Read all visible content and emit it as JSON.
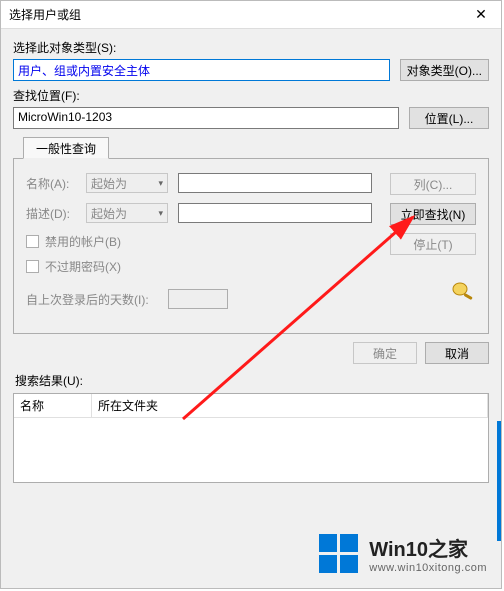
{
  "title": "选择用户或组",
  "section": {
    "objectTypeLabel": "选择此对象类型(S):",
    "objectTypeValue": "用户、组或内置安全主体",
    "objectTypeBtn": "对象类型(O)...",
    "locationLabel": "查找位置(F):",
    "locationValue": "MicroWin10-1203",
    "locationBtn": "位置(L)..."
  },
  "tab": {
    "label": "一般性查询",
    "nameLabel": "名称(A):",
    "nameCombo": "起始为",
    "descLabel": "描述(D):",
    "descCombo": "起始为",
    "chkDisabled": "禁用的帐户(B)",
    "chkNoExpire": "不过期密码(X)",
    "lastLoginLabel": "自上次登录后的天数(I):"
  },
  "sidebar": {
    "columns": "列(C)...",
    "findNow": "立即查找(N)",
    "stop": "停止(T)"
  },
  "buttons": {
    "ok": "确定",
    "cancel": "取消"
  },
  "results": {
    "label": "搜索结果(U):",
    "colName": "名称",
    "colFolder": "所在文件夹"
  },
  "watermark": {
    "title": "Win10之家",
    "url": "www.win10xitong.com"
  },
  "icons": {
    "close": "✕",
    "dropdown": "▾"
  }
}
